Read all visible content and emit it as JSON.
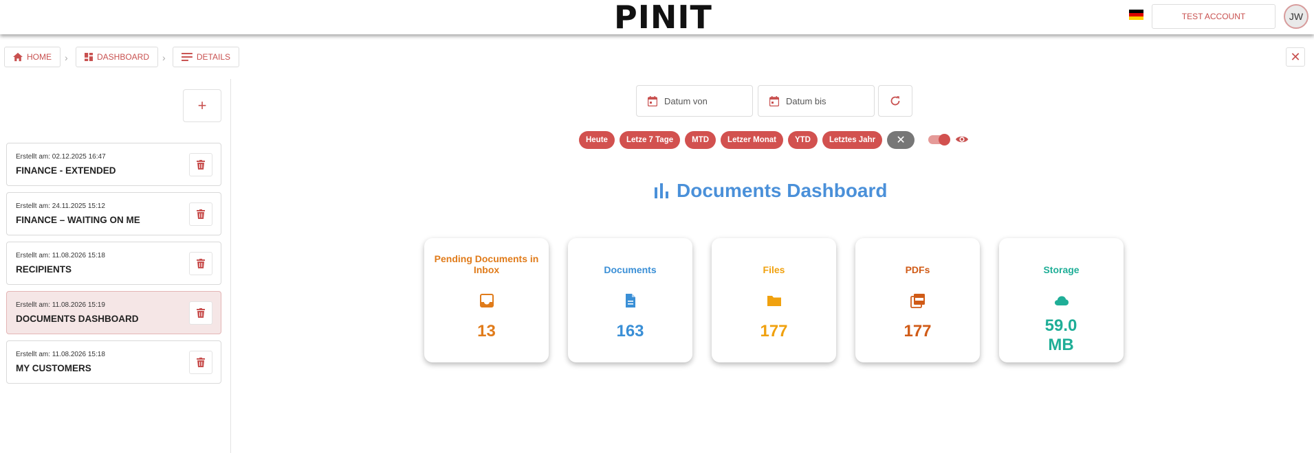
{
  "header": {
    "logo_text": "PINIT",
    "account_label": "TEST ACCOUNT",
    "avatar_initials": "JW"
  },
  "breadcrumb": [
    {
      "label": "HOME",
      "icon": "home-icon"
    },
    {
      "label": "DASHBOARD",
      "icon": "dashboard-icon"
    },
    {
      "label": "DETAILS",
      "icon": "list-icon"
    }
  ],
  "sidebar": {
    "items": [
      {
        "date": "Erstellt am: 02.12.2025 16:47",
        "title": "FINANCE - EXTENDED",
        "active": false
      },
      {
        "date": "Erstellt am: 24.11.2025 15:12",
        "title": "FINANCE – WAITING ON ME",
        "active": false
      },
      {
        "date": "Erstellt am: 11.08.2026 15:18",
        "title": "RECIPIENTS",
        "active": false
      },
      {
        "date": "Erstellt am: 11.08.2026 15:19",
        "title": "DOCUMENTS DASHBOARD",
        "active": true
      },
      {
        "date": "Erstellt am: 11.08.2026 15:18",
        "title": "MY CUSTOMERS",
        "active": false
      }
    ]
  },
  "filters": {
    "date_from_placeholder": "Datum von",
    "date_to_placeholder": "Datum bis",
    "chips": [
      "Heute",
      "Letze 7 Tage",
      "MTD",
      "Letzer Monat",
      "YTD",
      "Letztes Jahr"
    ]
  },
  "dashboard": {
    "title": "Documents Dashboard",
    "cards": [
      {
        "label": "Pending Documents in Inbox",
        "value": "13",
        "color": "#e07b1a",
        "icon": "inbox-icon"
      },
      {
        "label": "Documents",
        "value": "163",
        "color": "#3a8fd6",
        "icon": "document-icon"
      },
      {
        "label": "Files",
        "value": "177",
        "color": "#f0a10f",
        "icon": "folder-icon"
      },
      {
        "label": "PDFs",
        "value": "177",
        "color": "#d05b17",
        "icon": "pdf-icon"
      },
      {
        "label": "Storage",
        "value": "59.0 MB",
        "color": "#1fae97",
        "icon": "cloud-icon"
      }
    ]
  },
  "colors": {
    "accent": "#c8504f",
    "chip": "#d2514f",
    "title_blue": "#4a90d9"
  }
}
